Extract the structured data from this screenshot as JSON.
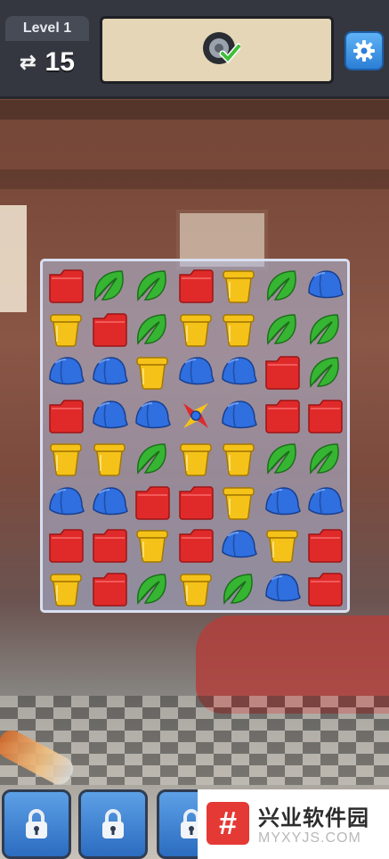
{
  "header": {
    "level_label": "Level 1",
    "moves_icon": "swap-arrows-icon",
    "moves_count": "15",
    "goal_icon": "tire-checkmark-icon",
    "settings_icon": "gear-icon"
  },
  "board": {
    "rows": [
      [
        "folder",
        "leaf",
        "leaf",
        "folder",
        "bucket",
        "leaf",
        "cap"
      ],
      [
        "bucket",
        "folder",
        "leaf",
        "bucket",
        "bucket",
        "leaf",
        "leaf"
      ],
      [
        "cap",
        "cap",
        "bucket",
        "cap",
        "cap",
        "folder",
        "leaf"
      ],
      [
        "folder",
        "cap",
        "cap",
        "spinner",
        "cap",
        "folder",
        "folder"
      ],
      [
        "bucket",
        "bucket",
        "leaf",
        "bucket",
        "bucket",
        "leaf",
        "leaf"
      ],
      [
        "cap",
        "cap",
        "folder",
        "folder",
        "bucket",
        "cap",
        "cap"
      ],
      [
        "folder",
        "folder",
        "bucket",
        "folder",
        "cap",
        "bucket",
        "folder"
      ],
      [
        "bucket",
        "folder",
        "leaf",
        "bucket",
        "leaf",
        "cap",
        "folder"
      ]
    ],
    "colors": {
      "folder": "#e02a2a",
      "leaf": "#36b533",
      "cap": "#2f6fe0",
      "bucket": "#f5c21a"
    }
  },
  "booster_bar": {
    "items": [
      "lock-icon",
      "lock-icon",
      "lock-icon"
    ]
  },
  "watermark": {
    "logo_glyph": "#",
    "chinese_text": "兴业软件园",
    "english_text": "MYXYJS.COM"
  }
}
